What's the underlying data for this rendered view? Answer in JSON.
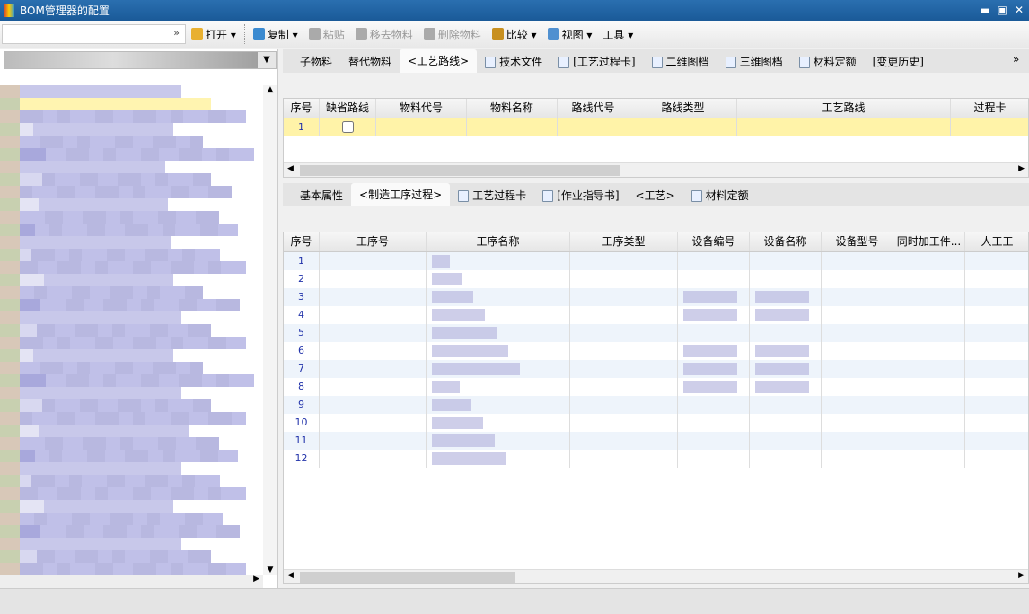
{
  "window": {
    "title": "BOM管理器的配置",
    "min": "▬",
    "max": "▣",
    "close": "✕"
  },
  "toolbar": {
    "combo_arrow": "»",
    "items": [
      {
        "label": "打开 ▾",
        "icon": "folder-icon",
        "enabled": true,
        "color": "#e8b030"
      },
      {
        "label": "复制 ▾",
        "icon": "copy-icon",
        "enabled": true,
        "color": "#3a8ad0"
      },
      {
        "label": "粘贴",
        "icon": "paste-icon",
        "enabled": false,
        "color": "#aaaaaa"
      },
      {
        "label": "移去物料",
        "icon": "remove-item-icon",
        "enabled": false,
        "color": "#aaaaaa"
      },
      {
        "label": "删除物料",
        "icon": "delete-icon",
        "enabled": false,
        "color": "#aaaaaa"
      },
      {
        "label": "比较 ▾",
        "icon": "scale-icon",
        "enabled": true,
        "color": "#c89020"
      },
      {
        "label": "视图 ▾",
        "icon": "view-icon",
        "enabled": true,
        "color": "#5090d0"
      },
      {
        "label": "工具 ▾",
        "icon": "tools-icon",
        "enabled": true,
        "color": ""
      }
    ]
  },
  "top_tabs": {
    "items": [
      "子物料",
      "替代物料",
      "<工艺路线>",
      "技术文件",
      "[工艺过程卡]",
      "二维图档",
      "三维图档",
      "材料定额",
      "[变更历史]"
    ],
    "active": 2,
    "more": "»"
  },
  "route_grid": {
    "columns": [
      "序号",
      "缺省路线",
      "物料代号",
      "物料名称",
      "路线代号",
      "路线类型",
      "工艺路线",
      "过程卡"
    ],
    "rows": [
      {
        "no": "1",
        "default": false
      }
    ]
  },
  "bottom_tabs": {
    "items": [
      "基本属性",
      "<制造工序过程>",
      "工艺过程卡",
      "[作业指导书]",
      "<工艺>",
      "材料定额"
    ],
    "active": 1
  },
  "process_grid": {
    "columns": [
      "序号",
      "工序号",
      "工序名称",
      "工序类型",
      "设备编号",
      "设备名称",
      "设备型号",
      "同时加工件...",
      "人工工"
    ],
    "rows": [
      "1",
      "2",
      "3",
      "4",
      "5",
      "6",
      "7",
      "8",
      "9",
      "10",
      "11",
      "12"
    ]
  },
  "colors": {
    "title_bar": "#1f64a3",
    "selected_row": "#fff3a8",
    "accent_text": "#2233aa"
  }
}
